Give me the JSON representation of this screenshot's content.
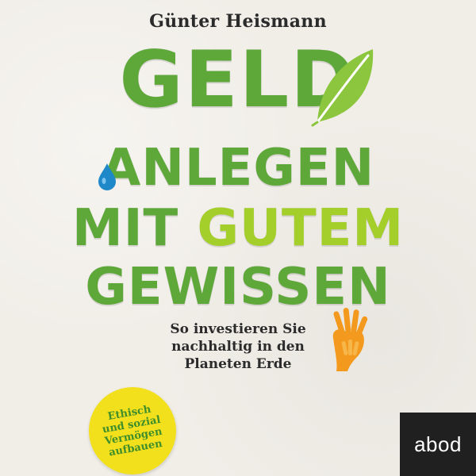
{
  "book": {
    "author": "Günter Heismann",
    "title": {
      "line1": "GELD",
      "line2": "ANLEGEN",
      "line3_part1": "MIT ",
      "line3_part2": "GUTEM",
      "line4": "GEWISSEN"
    },
    "subtitle": {
      "line1": "So investieren Sie",
      "line2": "nachhaltig in den",
      "line3": "Planeten Erde"
    },
    "badge": {
      "line1": "Ethisch",
      "line2": "und sozial",
      "line3": "Vermögen",
      "line4": "aufbauen"
    },
    "publisher": "abod"
  },
  "icons": {
    "leaf": "leaf-icon",
    "drop": "water-drop-icon",
    "hands": "hands-icon"
  },
  "colors": {
    "background": "#f1eee8",
    "title_green": "#5ea83a",
    "accent_lime": "#a4cf2a",
    "badge_yellow": "#f2e01d",
    "badge_text": "#3f8e2a",
    "drop_blue": "#1f88c8",
    "hands_orange": "#f39a1e",
    "publisher_bg": "#202020"
  }
}
